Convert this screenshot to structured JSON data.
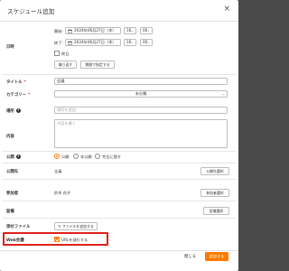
{
  "dialog": {
    "title": "スケジュール追加",
    "close_icon": "×"
  },
  "datetime": {
    "label": "日時",
    "start_label": "開始:",
    "start_date": "2024年06月27日（木）",
    "start_hour": "16",
    "start_min": "00",
    "end_label": "終了:",
    "end_date": "2024年06月27日（木）",
    "end_hour": "16",
    "end_min": "00",
    "allday_label": "終日",
    "allday_checked": false,
    "repeat_button": "繰り返す",
    "period_button": "期間で指定する"
  },
  "title_field": {
    "label": "タイトル",
    "value": "会議"
  },
  "category": {
    "label": "カテゴリー",
    "value": "未分類"
  },
  "place": {
    "label": "場所",
    "placeholder": "場所を追加"
  },
  "content": {
    "label": "内容",
    "placeholder": "内容を書く"
  },
  "visibility": {
    "label": "公開",
    "options": [
      "公開",
      "非公開",
      "完全に隠す"
    ],
    "selected": "公開"
  },
  "publish_to": {
    "label": "公開先",
    "value": "全員",
    "button": "公開先選択"
  },
  "participants": {
    "label": "参加者",
    "value": "鈴木 花子",
    "button": "参加者選択"
  },
  "equipment": {
    "label": "設備",
    "button": "設備選択"
  },
  "attachment": {
    "label": "添付ファイル",
    "button": "ファイルを追加する"
  },
  "web_meeting": {
    "label": "Web会議",
    "checkbox_label": "URLを発行する",
    "checked": true
  },
  "footer": {
    "close_label": "閉じる",
    "save_label": "追加する"
  },
  "colors": {
    "accent": "#ff7a00",
    "highlight": "#e0211a"
  }
}
